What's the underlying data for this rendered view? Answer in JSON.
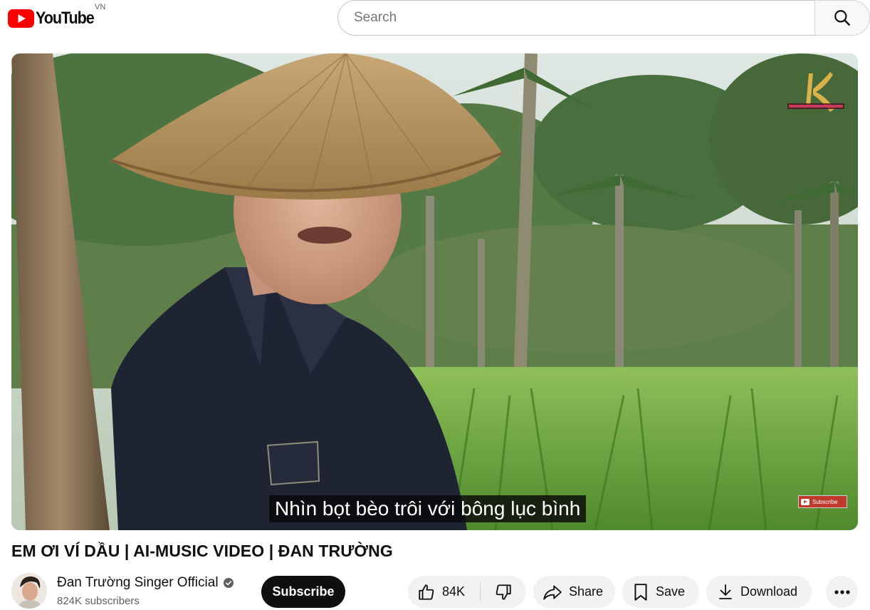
{
  "header": {
    "logo_text": "YouTube",
    "country_code": "VN",
    "search_placeholder": "Search"
  },
  "player": {
    "caption": "Nhìn bọt bèo trôi với bông lục bình",
    "subscribe_watermark": "Subscribe"
  },
  "video": {
    "title": "EM ƠI VÍ DẦU | AI-MUSIC VIDEO | ĐAN TRƯỜNG"
  },
  "channel": {
    "name": "Đan Trường Singer Official",
    "subscribers": "824K subscribers",
    "subscribe_label": "Subscribe"
  },
  "actions": {
    "like_count": "84K",
    "share_label": "Share",
    "save_label": "Save",
    "download_label": "Download"
  },
  "colors": {
    "brand_red": "#ff0000",
    "text_primary": "#0f0f0f",
    "text_secondary": "#606060",
    "button_bg": "#f2f2f2",
    "subscribe_bg": "#0f0f0f"
  }
}
